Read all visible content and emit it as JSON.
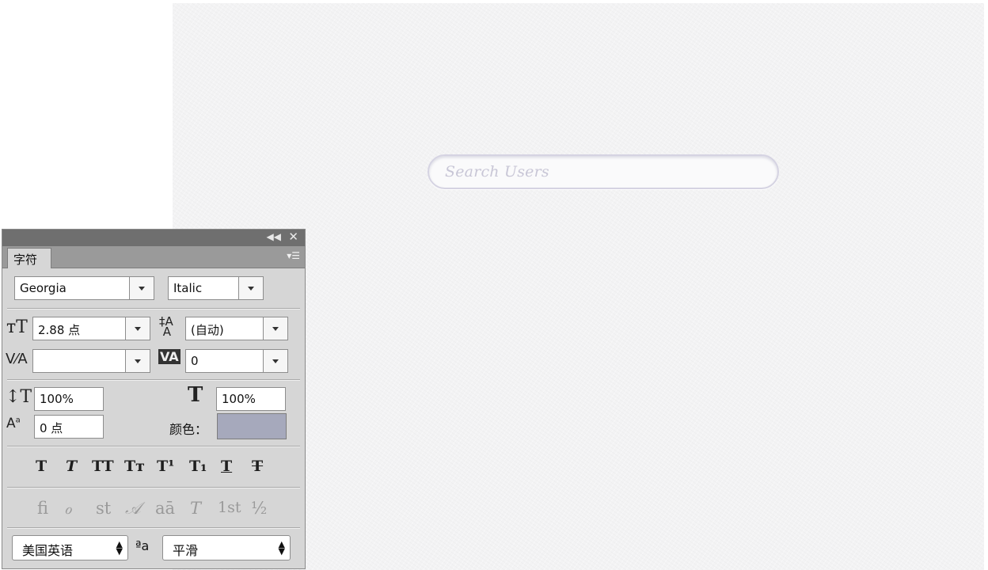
{
  "canvas": {
    "search_placeholder": "Search Users"
  },
  "panel": {
    "tab_label": "字符",
    "font_family": "Georgia",
    "font_style": "Italic",
    "font_size": "2.88 点",
    "leading": "(自动)",
    "kerning": "",
    "tracking": "0",
    "vertical_scale": "100%",
    "horizontal_scale": "100%",
    "baseline_shift": "0 点",
    "color_label": "颜色：",
    "color_value": "#a6a9bc",
    "type_style_buttons": [
      "T",
      "T",
      "TT",
      "Tт",
      "T¹",
      "T₁",
      "T",
      "T"
    ],
    "opentype_buttons": [
      "ﬁ",
      "ℴ",
      "st",
      "𝒜",
      "aā",
      "T",
      "1st",
      "½"
    ],
    "language": "美国英语",
    "aa_label": "ªa",
    "antialias": "平滑"
  }
}
